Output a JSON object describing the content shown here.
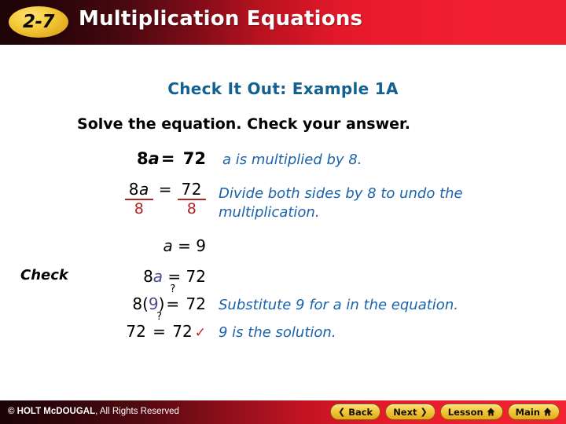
{
  "header": {
    "lesson_number": "2-7",
    "title": "Multiplication Equations",
    "gradient_start": "#1d0406",
    "gradient_end": "#f12030",
    "badge_color": "#f6cc3c"
  },
  "slide": {
    "example_title": "Check It Out: Example 1A",
    "instruction": "Solve the equation. Check your answer.",
    "accent_blue": "#1a62ab",
    "title_blue": "#14618f",
    "red": "#b22222",
    "variable_blue": "#4b4b8f"
  },
  "work": {
    "step1": {
      "coefficient": "8",
      "variable": "a",
      "equals": "=",
      "result": "72"
    },
    "step2": {
      "left_numerator_coefficient": "8",
      "left_numerator_variable": "a",
      "left_denominator": "8",
      "equals": "=",
      "right_numerator": "72",
      "right_denominator": "8"
    },
    "step3": {
      "variable": "a",
      "equals": "=",
      "value": "9"
    },
    "check": {
      "label": "Check",
      "line1": {
        "coefficient": "8",
        "variable": "a",
        "equals": "=",
        "result": "72"
      },
      "line2": {
        "expression": "8(",
        "substituted": "9",
        "close": ")",
        "question": "?",
        "equals": "=",
        "result": "72"
      },
      "line3": {
        "left": "72",
        "question": "?",
        "equals": "=",
        "right": "72",
        "checkmark": "✓"
      }
    }
  },
  "notes": {
    "note1": "a is multiplied by 8.",
    "note2": "Divide both sides by 8 to undo the multiplication.",
    "note3": "Substitute 9 for a in the equation.",
    "note4": "9 is the solution."
  },
  "footer": {
    "copyright_brand": "© HOLT McDOUGAL",
    "copyright_rest": ", All Rights Reserved",
    "buttons": [
      {
        "label": "Back",
        "glyph": "❮",
        "glyph_side": "left",
        "icon": "chevron-left-icon"
      },
      {
        "label": "Next",
        "glyph": "❯",
        "glyph_side": "right",
        "icon": "chevron-right-icon"
      },
      {
        "label": "Lesson",
        "glyph": "home",
        "glyph_side": "right",
        "icon": "home-icon"
      },
      {
        "label": "Main",
        "glyph": "home",
        "glyph_side": "right",
        "icon": "home-icon"
      }
    ]
  }
}
